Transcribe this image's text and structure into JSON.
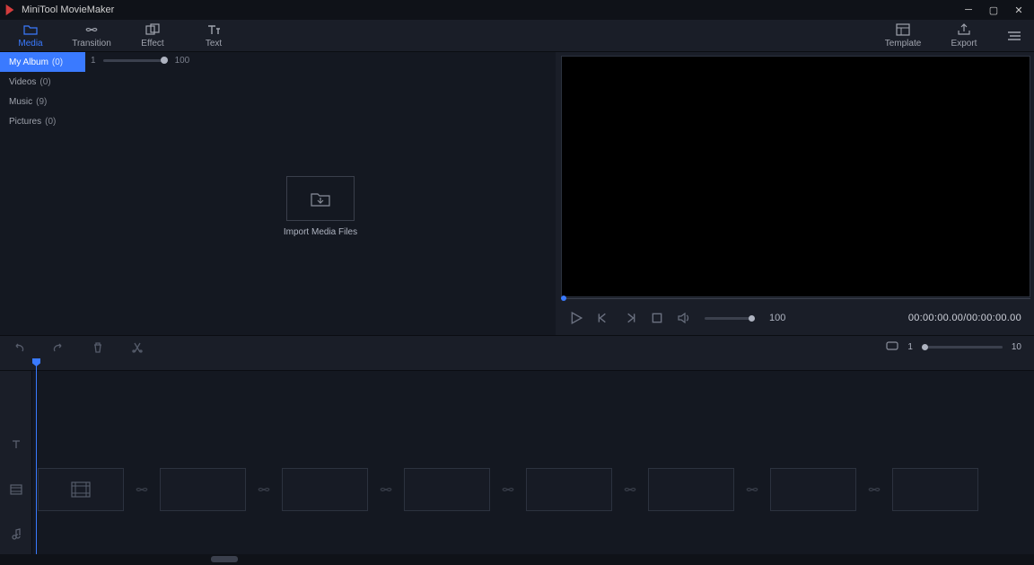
{
  "app": {
    "title": "MiniTool MovieMaker"
  },
  "toolbar": {
    "tabs": [
      {
        "label": "Media",
        "active": true
      },
      {
        "label": "Transition"
      },
      {
        "label": "Effect"
      },
      {
        "label": "Text"
      }
    ],
    "template_label": "Template",
    "export_label": "Export"
  },
  "sidebar": {
    "items": [
      {
        "label": "My Album",
        "count": "(0)",
        "selected": true
      },
      {
        "label": "Videos",
        "count": "(0)"
      },
      {
        "label": "Music",
        "count": "(9)"
      },
      {
        "label": "Pictures",
        "count": "(0)"
      }
    ]
  },
  "media_panel": {
    "zoom_min": "1",
    "zoom_max": "100",
    "import_label": "Import Media Files"
  },
  "preview": {
    "volume": "100",
    "timecode": "00:00:00.00/00:00:00.00"
  },
  "timeline_toolbar": {
    "zoom_min": "1",
    "zoom_max": "10"
  }
}
